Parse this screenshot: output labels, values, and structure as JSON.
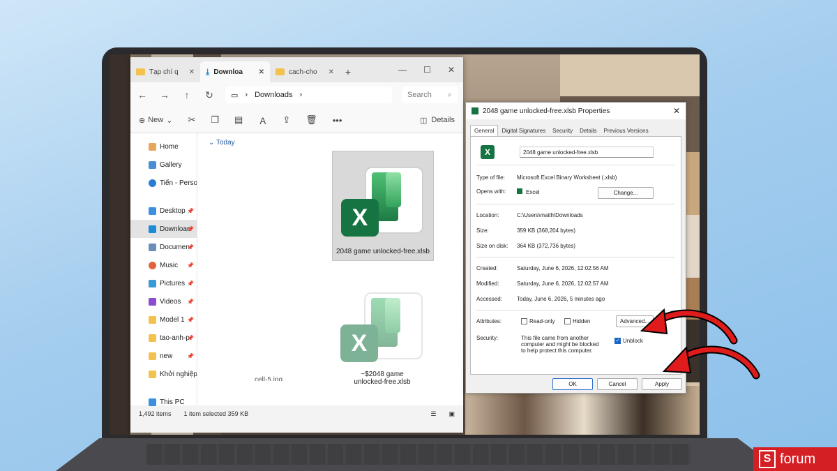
{
  "explorer": {
    "tabs": [
      {
        "label": "Tạp chí q",
        "active": false
      },
      {
        "label": "Downloa",
        "active": true
      },
      {
        "label": "cach-cho",
        "active": false
      }
    ],
    "window_controls": [
      "—",
      "☐",
      "✕"
    ],
    "path": "Downloads",
    "search_placeholder": "Search",
    "toolbar": {
      "new_label": "New",
      "details_label": "Details"
    },
    "sidebar": [
      {
        "label": "Home"
      },
      {
        "label": "Gallery"
      },
      {
        "label": "Tiến - Person"
      },
      {
        "label": "Desktop"
      },
      {
        "label": "Downloac"
      },
      {
        "label": "Documen"
      },
      {
        "label": "Music"
      },
      {
        "label": "Pictures"
      },
      {
        "label": "Videos"
      },
      {
        "label": "Model 1"
      },
      {
        "label": "tao-anh-p"
      },
      {
        "label": "new"
      },
      {
        "label": "Khởi nghiệp,"
      },
      {
        "label": "This PC"
      }
    ],
    "group_label": "Today",
    "files": [
      {
        "name": "2048 game unlocked-free.xlsb"
      },
      {
        "name": "~$2048 game unlocked-free.xlsb"
      }
    ],
    "partial_label": "cell-5.jpg",
    "status": {
      "items": "1,492 items",
      "selected": "1 item selected  359 KB"
    }
  },
  "properties": {
    "title": "2048 game unlocked-free.xlsb Properties",
    "tabs": [
      "General",
      "Digital Signatures",
      "Security",
      "Details",
      "Previous Versions"
    ],
    "filename": "2048 game unlocked-free.xlsb",
    "type_label": "Type of file:",
    "type_value": "Microsoft Excel Binary Worksheet (.xlsb)",
    "opens_label": "Opens with:",
    "opens_value": "Excel",
    "change_button": "Change...",
    "location_label": "Location:",
    "location_value": "C:\\Users\\maith\\Downloads",
    "size_label": "Size:",
    "size_value": "359 KB (368,204 bytes)",
    "disk_label": "Size on disk:",
    "disk_value": "364 KB (372,736 bytes)",
    "created_label": "Created:",
    "created_value": "Saturday, June 6, 2026, 12:02:56 AM",
    "modified_label": "Modified:",
    "modified_value": "Saturday, June 6, 2026, 12:02:57 AM",
    "accessed_label": "Accessed:",
    "accessed_value": "Today, June 6, 2026, 5 minutes ago",
    "attributes_label": "Attributes:",
    "readonly_label": "Read-only",
    "hidden_label": "Hidden",
    "advanced_button": "Advanced...",
    "security_label": "Security:",
    "security_text": "This file came from another computer and might be blocked to help protect this computer.",
    "unblock_label": "Unblock",
    "unblock_checked": true,
    "ok_button": "OK",
    "cancel_button": "Cancel",
    "apply_button": "Apply"
  },
  "branding": {
    "text": "forum",
    "logo_letter": "S",
    "color": "#d42025"
  },
  "colors": {
    "arrow": "#e01b1b",
    "excel_green": "#167443"
  }
}
